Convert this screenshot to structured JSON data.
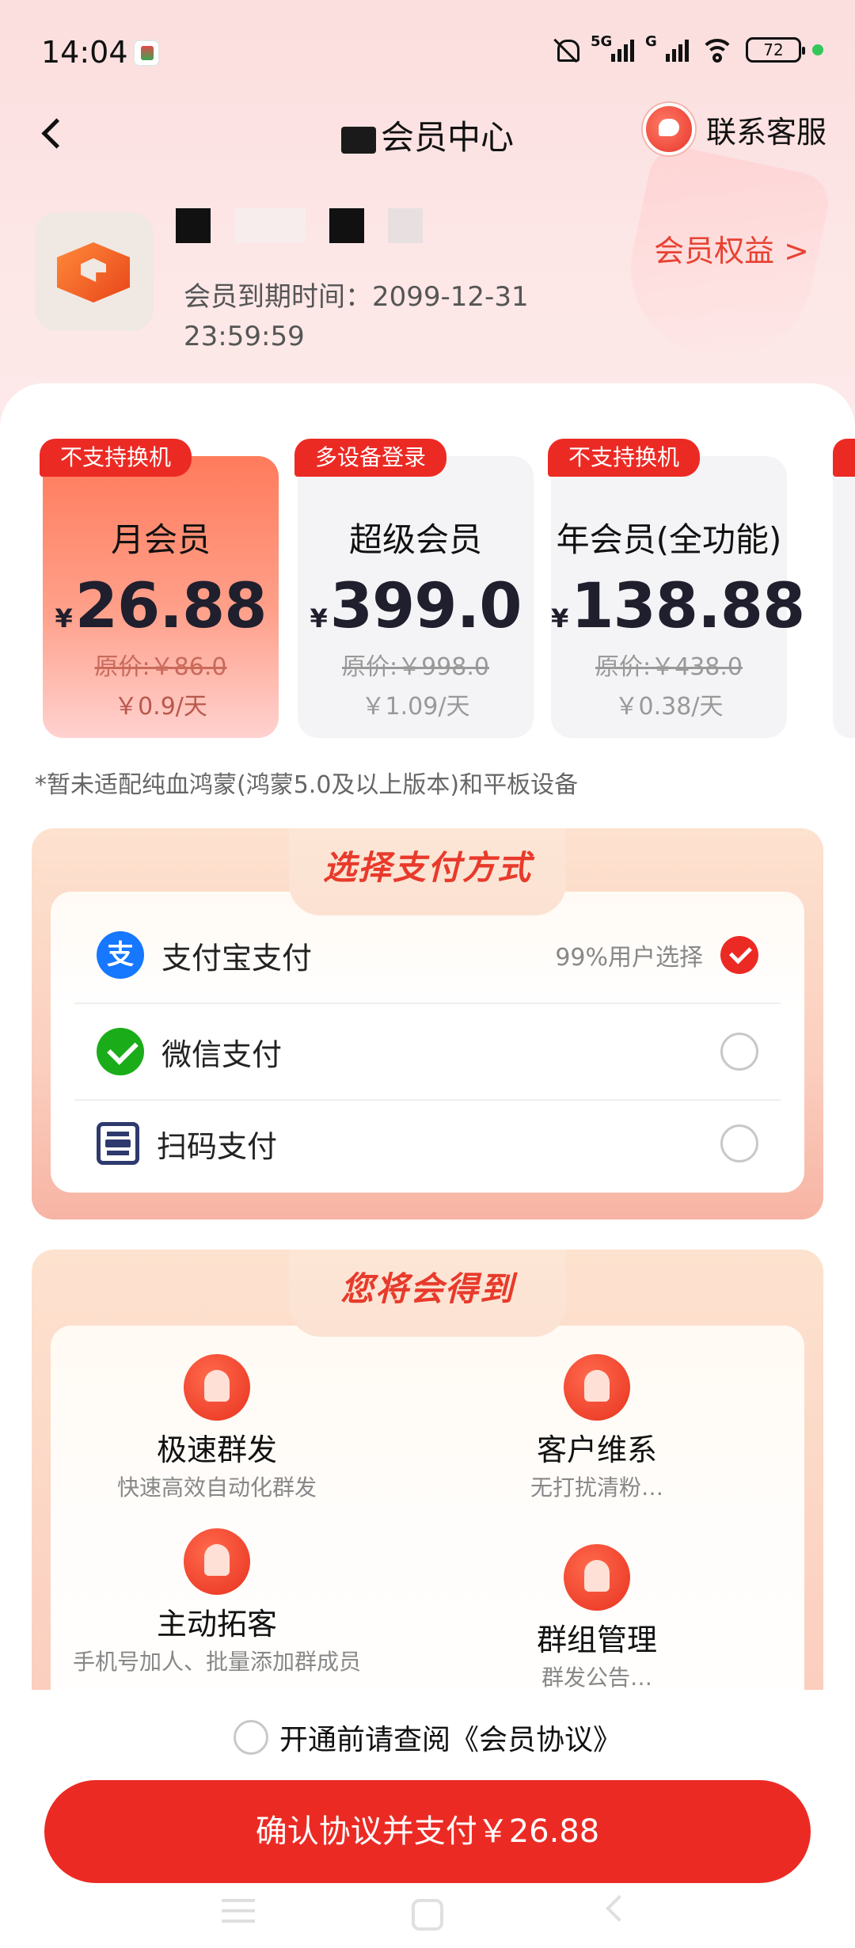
{
  "status_bar": {
    "time": "14:04",
    "network_1": "5G",
    "network_2": "G",
    "battery": "72"
  },
  "header": {
    "title": "会员中心",
    "title_visible": "■ 中心",
    "service_label": "联系客服"
  },
  "profile": {
    "expire_text": "会员到期时间：2099-12-31 23:59:59",
    "benefits_link": "会员权益 >"
  },
  "plans": [
    {
      "tag": "不支持换机",
      "name": "月会员",
      "currency": "¥",
      "price": "26.88",
      "original": "原价:￥86.0",
      "daily": "￥0.9/天",
      "selected": true
    },
    {
      "tag": "多设备登录",
      "name": "超级会员",
      "currency": "¥",
      "price": "399.0",
      "original": "原价:￥998.0",
      "daily": "￥1.09/天",
      "selected": false
    },
    {
      "tag": "不支持换机",
      "name": "年会员(全功能)",
      "currency": "¥",
      "price": "138.88",
      "original": "原价:￥438.0",
      "daily": "￥0.38/天",
      "selected": false
    }
  ],
  "note": "*暂未适配纯血鸿蒙(鸿蒙5.0及以上版本)和平板设备",
  "payment": {
    "title": "选择支付方式",
    "methods": [
      {
        "label": "支付宝支付",
        "hint": "99%用户选择",
        "icon": "alipay-icon",
        "checked": true
      },
      {
        "label": "微信支付",
        "hint": "",
        "icon": "wechat-pay-icon",
        "checked": false
      },
      {
        "label": "扫码支付",
        "hint": "",
        "icon": "scan-icon",
        "checked": false
      }
    ]
  },
  "gains": {
    "title": "您将会得到",
    "features": [
      {
        "title": "极速群发",
        "desc": "快速高效自动化群发",
        "icon": "rocket-icon"
      },
      {
        "title": "客户维系",
        "desc": "无打扰清粉…",
        "icon": "customer-icon"
      },
      {
        "title": "主动拓客",
        "desc": "手机号加人、批量添加群成员",
        "icon": "add-user-icon"
      },
      {
        "title": "群组管理",
        "desc": "群发公告…",
        "icon": "group-icon"
      }
    ]
  },
  "footer": {
    "agreement_text": "开通前请查阅《会员协议》",
    "pay_button": "确认协议并支付￥26.88"
  },
  "colors": {
    "accent": "#ec2a24",
    "link": "#e84233"
  }
}
